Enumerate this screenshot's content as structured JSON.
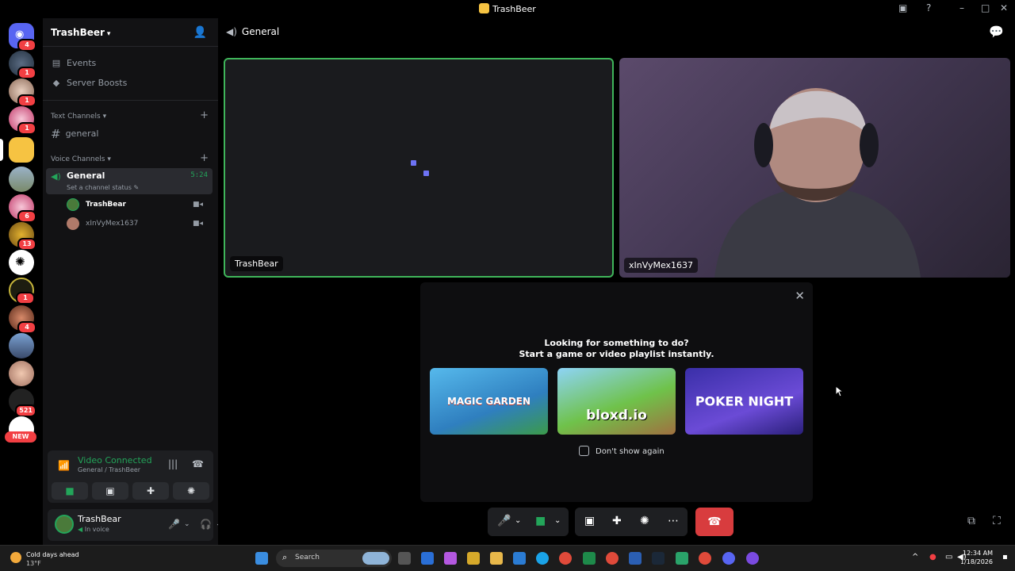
{
  "window": {
    "title": "TrashBeer"
  },
  "rail": {
    "badges": [
      "4",
      "1",
      "1",
      "1",
      "6",
      "13",
      "1",
      "4",
      "521"
    ],
    "new_label": "NEW"
  },
  "sidebar": {
    "server_name": "TrashBeer",
    "events_label": "Events",
    "boosts_label": "Server Boosts",
    "text_category": "Text Channels",
    "text_channel": "general",
    "voice_category": "Voice Channels",
    "voice_channel": "General",
    "voice_timer": "5:24",
    "voice_status": "Set a channel status",
    "voice_users": [
      "TrashBear",
      "xInVyMex1637"
    ]
  },
  "connection": {
    "title": "Video Connected",
    "subtitle": "General / TrashBeer"
  },
  "user": {
    "name": "TrashBear",
    "status": "In voice"
  },
  "main": {
    "channel": "General",
    "tiles": [
      "TrashBear",
      "xInVyMex1637"
    ]
  },
  "activity": {
    "line1": "Looking for something to do?",
    "line2": "Start a game or video playlist instantly.",
    "games": [
      "MAGIC GARDEN",
      "bloxd.io",
      "POKER NIGHT"
    ],
    "game_colors": [
      "#3fa3d9",
      "#6fc24a",
      "#6b4bd6"
    ],
    "dont_show": "Don't show again"
  },
  "taskbar": {
    "weather_title": "Cold days ahead",
    "weather_temp": "13°F",
    "search_placeholder": "Search",
    "time": "12:34 AM",
    "date": "1/18/2026"
  },
  "colors": {
    "accent_green": "#23a55a",
    "danger": "#d83c3e",
    "blurple": "#6d73f5"
  }
}
